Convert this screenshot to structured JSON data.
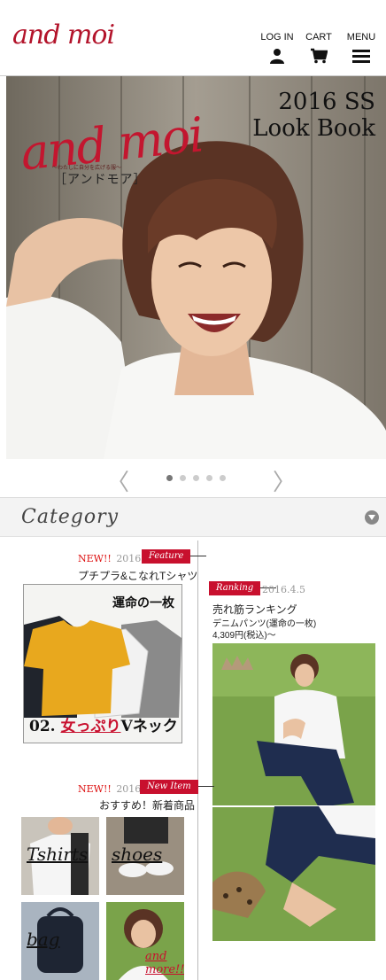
{
  "header": {
    "logo": "and moi",
    "nav": [
      {
        "label": "LOG IN",
        "icon": "user-icon"
      },
      {
        "label": "CART",
        "icon": "cart-icon"
      },
      {
        "label": "MENU",
        "icon": "hamburger-icon"
      }
    ]
  },
  "hero": {
    "logo": "and moi",
    "tagline": "～わたしに自分を広げる服～",
    "kana": "［アンドモア］",
    "title_line1": "2016 SS",
    "title_line2": "Look Book"
  },
  "slider": {
    "prev": "〈",
    "next": "〉",
    "dots": 5,
    "active_index": 0
  },
  "category": {
    "label": "Category"
  },
  "feature": {
    "new": "NEW!!",
    "date": "2016.4.5",
    "tag": "Feature",
    "title": "プチプラ&こなれTシャツ",
    "card_top": "運命の一枚",
    "card_bottom_num": "02.",
    "card_bottom_red": "女っぷり",
    "card_bottom_rest": "Vネック"
  },
  "ranking": {
    "tag": "Ranking",
    "date": "2016.4.5",
    "title": "売れ筋ランキング",
    "product": "デニムパンツ(運命の一枚)",
    "price": "4,309円(税込)～"
  },
  "new_item": {
    "new": "NEW!!",
    "date": "2016.4.5",
    "tag": "New Item",
    "title": "おすすめ！新着商品",
    "thumbs": [
      {
        "label": "Tshirts"
      },
      {
        "label": "shoes"
      },
      {
        "label": "bag"
      },
      {
        "label": "and more!!"
      }
    ]
  },
  "colors": {
    "brand_red": "#c8102e",
    "text": "#222222"
  }
}
